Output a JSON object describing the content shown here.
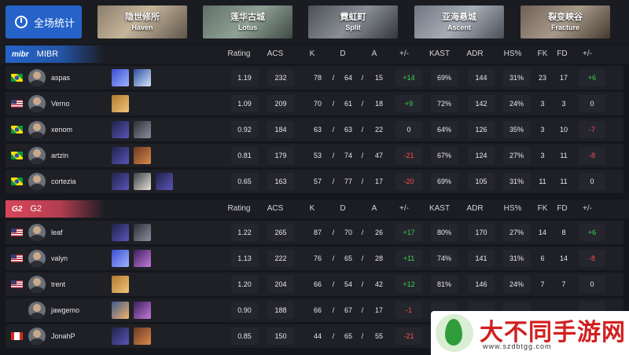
{
  "topbar": {
    "all_stats_label": "全场统计",
    "maps": [
      {
        "zh": "隐世修所",
        "en": "Haven"
      },
      {
        "zh": "莲华古城",
        "en": "Lotus"
      },
      {
        "zh": "霓虹町",
        "en": "Split"
      },
      {
        "zh": "亚海悬城",
        "en": "Ascent"
      },
      {
        "zh": "裂变峡谷",
        "en": "Fracture"
      }
    ]
  },
  "columns": [
    "Rating",
    "ACS",
    "K",
    "D",
    "A",
    "+/-",
    "KAST",
    "ADR",
    "HS%",
    "FK",
    "FD",
    "+/-"
  ],
  "teams": [
    {
      "name": "MIBR",
      "logo_text": "mibr",
      "color": "#2563c9",
      "players": [
        {
          "name": "aspas",
          "flag": "br",
          "agents": [
            "neon",
            "jett"
          ],
          "rating": "1.19",
          "acs": "232",
          "k": "78",
          "d": "64",
          "a": "15",
          "diff": "+14",
          "diff_sign": "pos",
          "kast": "69%",
          "adr": "144",
          "hs": "31%",
          "fk": "23",
          "fd": "17",
          "fdiff": "+6",
          "fdiff_sign": "pos"
        },
        {
          "name": "Verno",
          "flag": "us",
          "agents": [
            "raze"
          ],
          "rating": "1.09",
          "acs": "209",
          "k": "70",
          "d": "61",
          "a": "18",
          "diff": "+9",
          "diff_sign": "pos",
          "kast": "72%",
          "adr": "142",
          "hs": "24%",
          "fk": "3",
          "fd": "3",
          "fdiff": "0",
          "fdiff_sign": "zero"
        },
        {
          "name": "xenom",
          "flag": "br",
          "agents": [
            "omen",
            "kayo"
          ],
          "rating": "0.92",
          "acs": "184",
          "k": "63",
          "d": "63",
          "a": "22",
          "diff": "0",
          "diff_sign": "zero",
          "kast": "64%",
          "adr": "126",
          "hs": "35%",
          "fk": "3",
          "fd": "10",
          "fdiff": "-7",
          "fdiff_sign": "neg"
        },
        {
          "name": "artzin",
          "flag": "br",
          "agents": [
            "omen",
            "breach"
          ],
          "rating": "0.81",
          "acs": "179",
          "k": "53",
          "d": "74",
          "a": "47",
          "diff": "-21",
          "diff_sign": "neg",
          "kast": "67%",
          "adr": "124",
          "hs": "27%",
          "fk": "3",
          "fd": "11",
          "fdiff": "-8",
          "fdiff_sign": "neg"
        },
        {
          "name": "cortezia",
          "flag": "br",
          "agents": [
            "omen",
            "cypher",
            "omen"
          ],
          "rating": "0.65",
          "acs": "163",
          "k": "57",
          "d": "77",
          "a": "17",
          "diff": "-20",
          "diff_sign": "neg",
          "kast": "69%",
          "adr": "105",
          "hs": "31%",
          "fk": "11",
          "fd": "11",
          "fdiff": "0",
          "fdiff_sign": "zero"
        }
      ]
    },
    {
      "name": "G2",
      "logo_text": "G2",
      "color": "#d9465a",
      "players": [
        {
          "name": "leaf",
          "flag": "us",
          "agents": [
            "omen",
            "kayo"
          ],
          "rating": "1.22",
          "acs": "265",
          "k": "87",
          "d": "70",
          "a": "26",
          "diff": "+17",
          "diff_sign": "pos",
          "kast": "80%",
          "adr": "170",
          "hs": "27%",
          "fk": "14",
          "fd": "8",
          "fdiff": "+6",
          "fdiff_sign": "pos"
        },
        {
          "name": "valyn",
          "flag": "us",
          "agents": [
            "neon",
            "reyna"
          ],
          "rating": "1.13",
          "acs": "222",
          "k": "76",
          "d": "65",
          "a": "28",
          "diff": "+11",
          "diff_sign": "pos",
          "kast": "74%",
          "adr": "141",
          "hs": "31%",
          "fk": "6",
          "fd": "14",
          "fdiff": "-8",
          "fdiff_sign": "neg"
        },
        {
          "name": "trent",
          "flag": "us",
          "agents": [
            "raze"
          ],
          "rating": "1.20",
          "acs": "204",
          "k": "66",
          "d": "54",
          "a": "42",
          "diff": "+12",
          "diff_sign": "pos",
          "kast": "81%",
          "adr": "146",
          "hs": "24%",
          "fk": "7",
          "fd": "7",
          "fdiff": "0",
          "fdiff_sign": "zero"
        },
        {
          "name": "jawgemo",
          "flag": "",
          "agents": [
            "phoenix",
            "reyna"
          ],
          "rating": "0.90",
          "acs": "188",
          "k": "66",
          "d": "67",
          "a": "17",
          "diff": "-1",
          "diff_sign": "neg",
          "kast": "",
          "adr": "",
          "hs": "",
          "fk": "",
          "fd": "",
          "fdiff": "",
          "fdiff_sign": "zero"
        },
        {
          "name": "JonahP",
          "flag": "ca",
          "agents": [
            "omen",
            "breach"
          ],
          "rating": "0.85",
          "acs": "150",
          "k": "44",
          "d": "65",
          "a": "55",
          "diff": "-21",
          "diff_sign": "neg",
          "kast": "",
          "adr": "",
          "hs": "",
          "fk": "",
          "fd": "",
          "fdiff": "",
          "fdiff_sign": "zero"
        }
      ]
    }
  ],
  "watermark": {
    "name": "大不同手游网",
    "url": "www.szdbtgg.com"
  }
}
